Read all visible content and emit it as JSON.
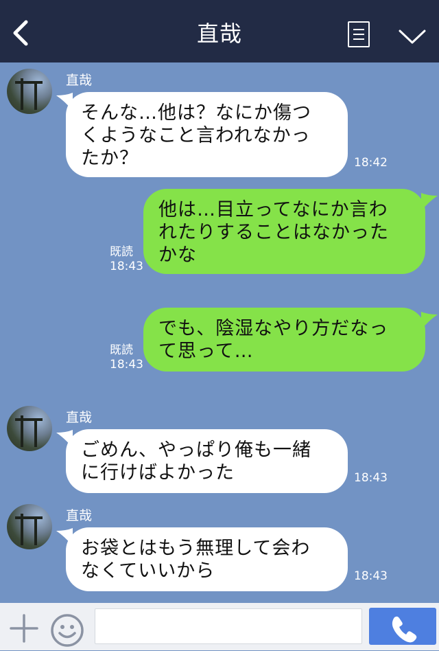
{
  "header": {
    "title": "直哉",
    "back_icon": "back-arrow-icon",
    "menu_icon": "list-menu-icon",
    "more_icon": "chevron-down-icon"
  },
  "messages": [
    {
      "direction": "in",
      "sender": "直哉",
      "lines": [
        "そんな…他は？なにか傷つ",
        "くようなこと言われなかっ",
        "たか？"
      ],
      "time": "18:42"
    },
    {
      "direction": "out",
      "read_label": "既読",
      "lines": [
        "他は…目立ってなにか言わ",
        "れたりすることはなかった",
        "かな"
      ],
      "time": "18:43"
    },
    {
      "direction": "out",
      "read_label": "既読",
      "lines": [
        "でも、陰湿なやり方だなっ",
        "て思って…"
      ],
      "time": "18:43"
    },
    {
      "direction": "in",
      "sender": "直哉",
      "lines": [
        "ごめん、やっぱり俺も一緒",
        "に行けばよかった"
      ],
      "time": "18:43"
    },
    {
      "direction": "in",
      "sender": "直哉",
      "lines": [
        "お袋とはもう無理して会わ",
        "なくていいから"
      ],
      "time": "18:43"
    }
  ],
  "input": {
    "value": "",
    "plus_icon": "plus-icon",
    "emoji_icon": "emoji-icon",
    "call_icon": "phone-icon"
  },
  "colors": {
    "header_bg": "#222b45",
    "chat_bg": "#7293c4",
    "incoming_bubble": "#ffffff",
    "outgoing_bubble": "#85e249",
    "call_button": "#4e7fe0"
  }
}
